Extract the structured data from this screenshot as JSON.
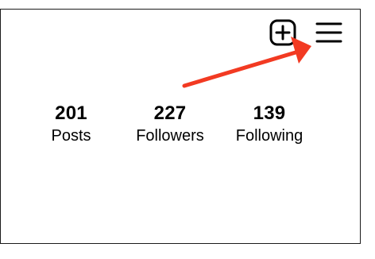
{
  "header": {
    "icons": {
      "new_post": "plus-square-icon",
      "menu": "hamburger-menu-icon"
    }
  },
  "stats": [
    {
      "value": "201",
      "label": "Posts"
    },
    {
      "value": "227",
      "label": "Followers"
    },
    {
      "value": "139",
      "label": "Following"
    }
  ],
  "annotation": {
    "arrow_color": "#f23a22",
    "points_to": "hamburger-menu-icon"
  }
}
